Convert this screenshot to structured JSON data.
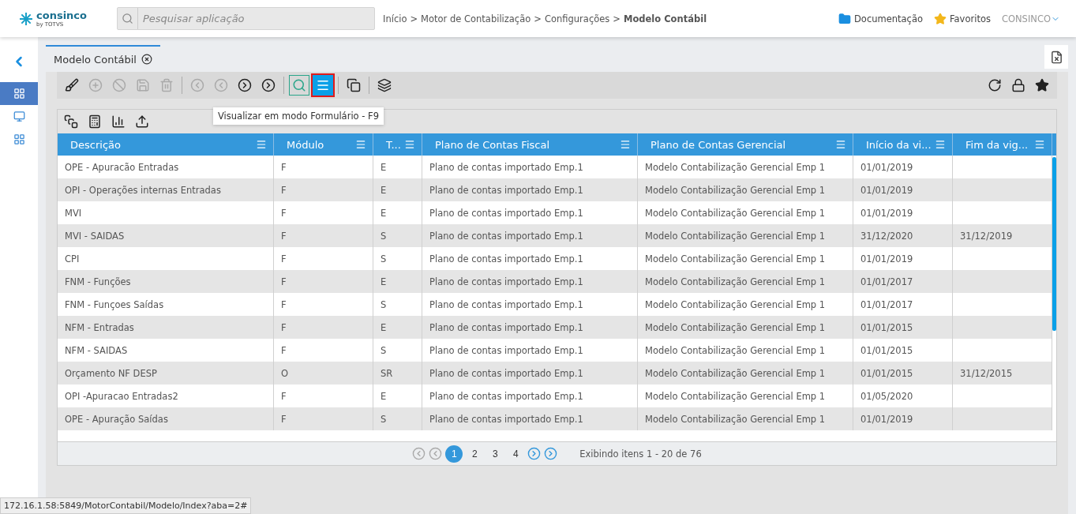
{
  "header": {
    "logo": "consinco",
    "logo_sub": "by",
    "logo_brand": "TOTVS",
    "search": {
      "placeholder": "Pesquisar aplicação"
    },
    "breadcrumb": [
      {
        "label": "Início",
        "current": false
      },
      {
        "label": "Motor de Contabilização",
        "current": false
      },
      {
        "label": "Configurações",
        "current": false
      },
      {
        "label": "Modelo Contábil",
        "current": true
      }
    ],
    "breadcrumb_separator": ">",
    "links": [
      {
        "kind": "folder",
        "label": "Documentação"
      },
      {
        "kind": "star",
        "label": "Favoritos"
      }
    ],
    "user": "CONSINCO"
  },
  "sidebar": {
    "items": [
      {
        "kind": "grid",
        "selected": true
      },
      {
        "kind": "monitor",
        "selected": false
      },
      {
        "kind": "grid",
        "selected": false
      }
    ]
  },
  "tabs": [
    {
      "label": "Modelo Contábil",
      "selected": true
    }
  ],
  "toolbar": [
    {
      "kind": "brush",
      "disabled": false,
      "selected": false,
      "focused": false
    },
    {
      "kind": "add",
      "disabled": true,
      "selected": false,
      "focused": false
    },
    {
      "kind": "cancel",
      "disabled": true,
      "selected": false,
      "focused": false
    },
    {
      "kind": "save",
      "disabled": true,
      "selected": false,
      "focused": false
    },
    {
      "kind": "delete",
      "disabled": true,
      "selected": false,
      "focused": false
    },
    {
      "kind": "sep"
    },
    {
      "kind": "first",
      "disabled": true,
      "selected": false,
      "focused": false
    },
    {
      "kind": "prev",
      "disabled": true,
      "selected": false,
      "focused": false
    },
    {
      "kind": "next",
      "disabled": false,
      "selected": false,
      "focused": false
    },
    {
      "kind": "last",
      "disabled": false,
      "selected": false,
      "focused": false
    },
    {
      "kind": "sep"
    },
    {
      "kind": "search",
      "disabled": false,
      "selected": true,
      "focused": false
    },
    {
      "kind": "form",
      "disabled": false,
      "selected": false,
      "focused": true
    },
    {
      "kind": "sep"
    },
    {
      "kind": "copy",
      "disabled": false,
      "selected": false,
      "focused": false
    },
    {
      "kind": "sep"
    },
    {
      "kind": "stack",
      "disabled": false,
      "selected": false,
      "focused": false
    }
  ],
  "tooltip": "Visualizar em modo Formulário - F9",
  "table": {
    "columns": [
      "Descrição",
      "Módulo",
      "T...",
      "Plano de Contas Fiscal",
      "Plano de Contas Gerencial",
      "Início da vi...",
      "Fim da vig..."
    ],
    "rows": [
      [
        "OPE - Apuracão Entradas",
        "F",
        "E",
        "Plano de contas importado Emp.1",
        "Modelo Contabilização Gerencial Emp 1",
        "01/01/2019",
        ""
      ],
      [
        "OPI - Operações internas Entradas",
        "F",
        "E",
        "Plano de contas importado Emp.1",
        "Modelo Contabilização Gerencial Emp 1",
        "01/01/2019",
        ""
      ],
      [
        "MVI",
        "F",
        "E",
        "Plano de contas importado Emp.1",
        "Modelo Contabilização Gerencial Emp 1",
        "01/01/2019",
        ""
      ],
      [
        "MVI - SAIDAS",
        "F",
        "S",
        "Plano de contas importado Emp.1",
        "Modelo Contabilização Gerencial Emp 1",
        "31/12/2020",
        "31/12/2019"
      ],
      [
        "CPI",
        "F",
        "S",
        "Plano de contas importado Emp.1",
        "Modelo Contabilização Gerencial Emp 1",
        "01/01/2019",
        ""
      ],
      [
        "FNM - Funções",
        "F",
        "E",
        "Plano de contas importado Emp.1",
        "Modelo Contabilização Gerencial Emp 1",
        "01/01/2017",
        ""
      ],
      [
        "FNM - Funçoes Saídas",
        "F",
        "S",
        "Plano de contas importado Emp.1",
        "Modelo Contabilização Gerencial Emp 1",
        "01/01/2017",
        ""
      ],
      [
        "NFM - Entradas",
        "F",
        "E",
        "Plano de contas importado Emp.1",
        "Modelo Contabilização Gerencial Emp 1",
        "01/01/2015",
        ""
      ],
      [
        "NFM - SAIDAS",
        "F",
        "S",
        "Plano de contas importado Emp.1",
        "Modelo Contabilização Gerencial Emp 1",
        "01/01/2015",
        ""
      ],
      [
        "Orçamento NF DESP",
        "O",
        "SR",
        "Plano de contas importado Emp.1",
        "Modelo Contabilização Gerencial Emp 1",
        "01/01/2015",
        "31/12/2015"
      ],
      [
        "OPI -Apuracao Entradas2",
        "F",
        "E",
        "Plano de contas importado Emp.1",
        "Modelo Contabilização Gerencial Emp 1",
        "01/05/2020",
        ""
      ],
      [
        "OPE - Apuração Saídas",
        "F",
        "S",
        "Plano de contas importado Emp.1",
        "Modelo Contabilização Gerencial Emp 1",
        "01/01/2019",
        ""
      ]
    ]
  },
  "pager": {
    "pages": [
      {
        "label": "1",
        "selected": true
      },
      {
        "label": "2",
        "selected": false
      },
      {
        "label": "3",
        "selected": false
      },
      {
        "label": "4",
        "selected": false
      }
    ],
    "summary": "Exibindo itens 1 - 20 de 76"
  },
  "status_bar": "172.16.1.58:5849/MotorContabil/Modelo/Index?aba=2#"
}
